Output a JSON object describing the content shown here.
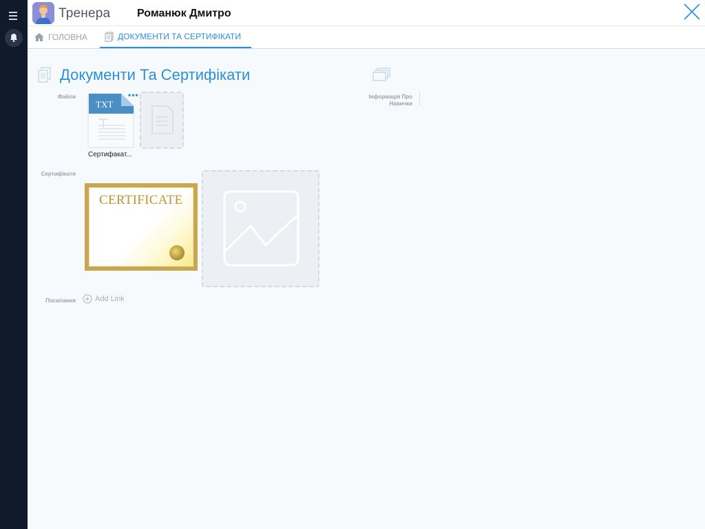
{
  "rail": {
    "menu_icon": "hamburger-icon",
    "bell_icon": "bell-icon"
  },
  "header": {
    "app_title": "Тренера",
    "user_name": "Романюк Дмитро",
    "close_icon": "close-icon"
  },
  "tabs": [
    {
      "label": "ГОЛОВНА",
      "icon": "home-icon"
    },
    {
      "label": "ДОКУМЕНТИ ТА СЕРТИФІКАТИ",
      "icon": "document-icon",
      "active": true
    }
  ],
  "section": {
    "title": "Документи Та Сертифікати",
    "files_label": "Файли",
    "certificates_label": "Сертифікати",
    "links_label": "Посилання",
    "add_link": "Add Link"
  },
  "files": [
    {
      "type": "TXT",
      "name": "Сертифакат..."
    }
  ],
  "certificate": {
    "title": "CERTIFICATE"
  },
  "info": {
    "label": "Інформація Про Навички"
  },
  "colors": {
    "accent": "#2a8fd9",
    "rail": "#0f1a2b"
  }
}
